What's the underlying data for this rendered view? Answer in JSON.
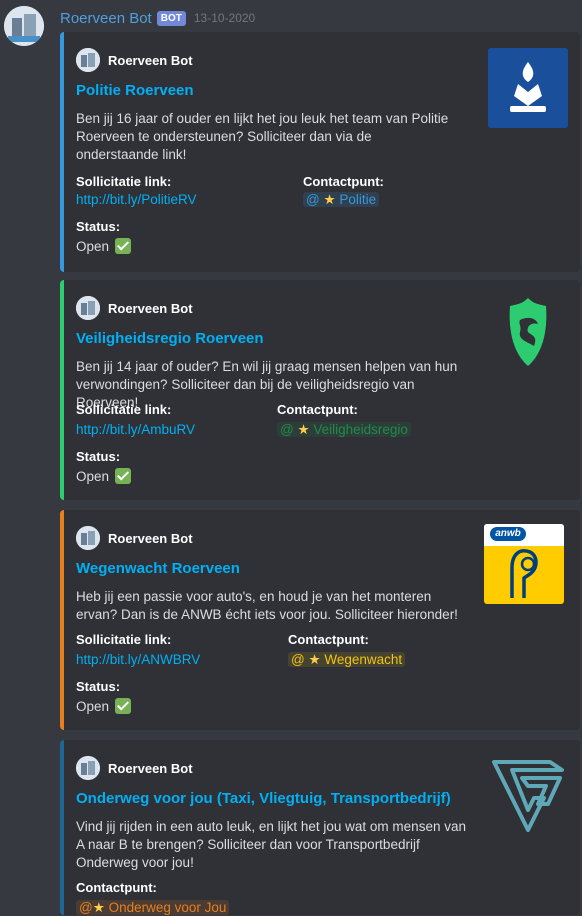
{
  "message": {
    "username": "Roerveen Bot",
    "badge": "BOT",
    "timestamp": "13-10-2020"
  },
  "embeds": [
    {
      "author": "Roerveen Bot",
      "title": "Politie Roerveen",
      "description": "Ben jij 16 jaar of ouder en lijkt het jou leuk het team van Politie Roerveen te ondersteunen? Solliciteer dan via de onderstaande link!",
      "link_label": "Sollicitatie link:",
      "link_value": "http://bit.ly/PolitieRV",
      "contact_label": "Contactpunt:",
      "contact_at": "@",
      "contact_value": "Politie",
      "status_label": "Status:",
      "status_value": "Open",
      "color": "#3498db"
    },
    {
      "author": "Roerveen Bot",
      "title": "Veiligheidsregio Roerveen",
      "description": "Ben jij 14 jaar of ouder? En wil jij graag mensen helpen van hun verwondingen? Solliciteer dan bij de veiligheidsregio van Roerveen!",
      "link_label": "Sollicitatie link:",
      "link_value": "http://bit.ly/AmbuRV",
      "contact_label": "Contactpunt:",
      "contact_at": "@",
      "contact_value": "Veiligheidsregio",
      "status_label": "Status:",
      "status_value": "Open",
      "color": "#2ecc71"
    },
    {
      "author": "Roerveen Bot",
      "title": "Wegenwacht Roerveen",
      "description": "Heb jij een passie voor auto's, en houd je van het monteren ervan? Dan is de ANWB écht iets voor jou. Solliciteer hieronder!",
      "link_label": "Sollicitatie link:",
      "link_value": "http://bit.ly/ANWBRV",
      "contact_label": "Contactpunt:",
      "contact_at": "@",
      "contact_value": "Wegenwacht",
      "status_label": "Status:",
      "status_value": "Open",
      "color": "#e67e22",
      "thumb_text": "anwb"
    },
    {
      "author": "Roerveen Bot",
      "title": "Onderweg voor jou (Taxi, Vliegtuig, Transportbedrijf)",
      "description": "Vind jij rijden in een auto leuk, en lijkt het jou wat om mensen van A naar B te brengen? Solliciteer dan voor Transportbedrijf Onderweg voor jou!",
      "contact_label": "Contactpunt:",
      "contact_at": "@",
      "contact_value": "Onderweg voor Jou",
      "color": "#206694"
    }
  ]
}
